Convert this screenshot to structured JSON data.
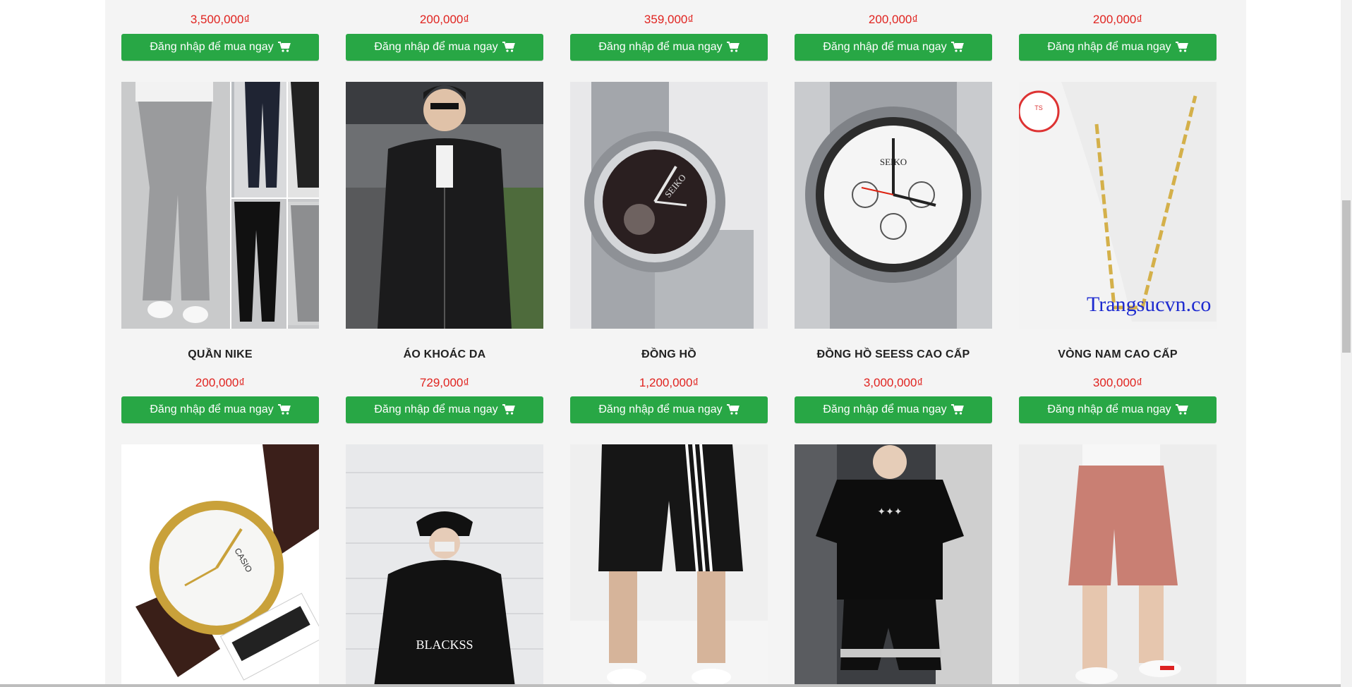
{
  "top_row": [
    {
      "price": "3,500,000₫",
      "button": "Đăng nhập để mua ngay"
    },
    {
      "price": "200,000₫",
      "button": "Đăng nhập để mua ngay"
    },
    {
      "price": "359,000₫",
      "button": "Đăng nhập để mua ngay"
    },
    {
      "price": "200,000₫",
      "button": "Đăng nhập để mua ngay"
    },
    {
      "price": "200,000₫",
      "button": "Đăng nhập để mua ngay"
    }
  ],
  "middle_row": [
    {
      "name": "QUẦN NIKE",
      "price": "200,000₫",
      "button": "Đăng nhập để mua ngay",
      "image": "grey-pants-photo"
    },
    {
      "name": "ÁO KHOÁC DA",
      "price": "729,000₫",
      "button": "Đăng nhập để mua ngay",
      "image": "leather-jacket-photo"
    },
    {
      "name": "ĐỒNG HỒ",
      "price": "1,200,000₫",
      "button": "Đăng nhập để mua ngay",
      "image": "dark-dial-watch-photo",
      "image_text": {
        "brand": "SEIKO"
      }
    },
    {
      "name": "ĐỒNG HỒ SEESS CAO CẤP",
      "price": "3,000,000₫",
      "button": "Đăng nhập để mua ngay",
      "image": "chronograph-watch-photo",
      "image_text": {
        "brand": "SEIKO"
      }
    },
    {
      "name": "VÒNG NAM CAO CẤP",
      "price": "300,000₫",
      "button": "Đăng nhập để mua ngay",
      "image": "gold-necklace-photo",
      "image_text": {
        "watermark": "Trangsucvn.co"
      }
    }
  ],
  "bottom_row": [
    {
      "image": "gold-watch-photo",
      "image_text": {
        "brand": "CASIO"
      }
    },
    {
      "image": "black-sweater-photo",
      "image_text": {
        "print": "BLACKSS"
      }
    },
    {
      "image": "black-shorts-photo"
    },
    {
      "image": "black-tshirt-set-photo"
    },
    {
      "image": "pink-shorts-photo"
    }
  ],
  "colors": {
    "price": "#e0231f",
    "button": "#28a745",
    "panel": "#f4f4f4"
  },
  "icons": {
    "button_icon": "shopping-cart-icon"
  }
}
